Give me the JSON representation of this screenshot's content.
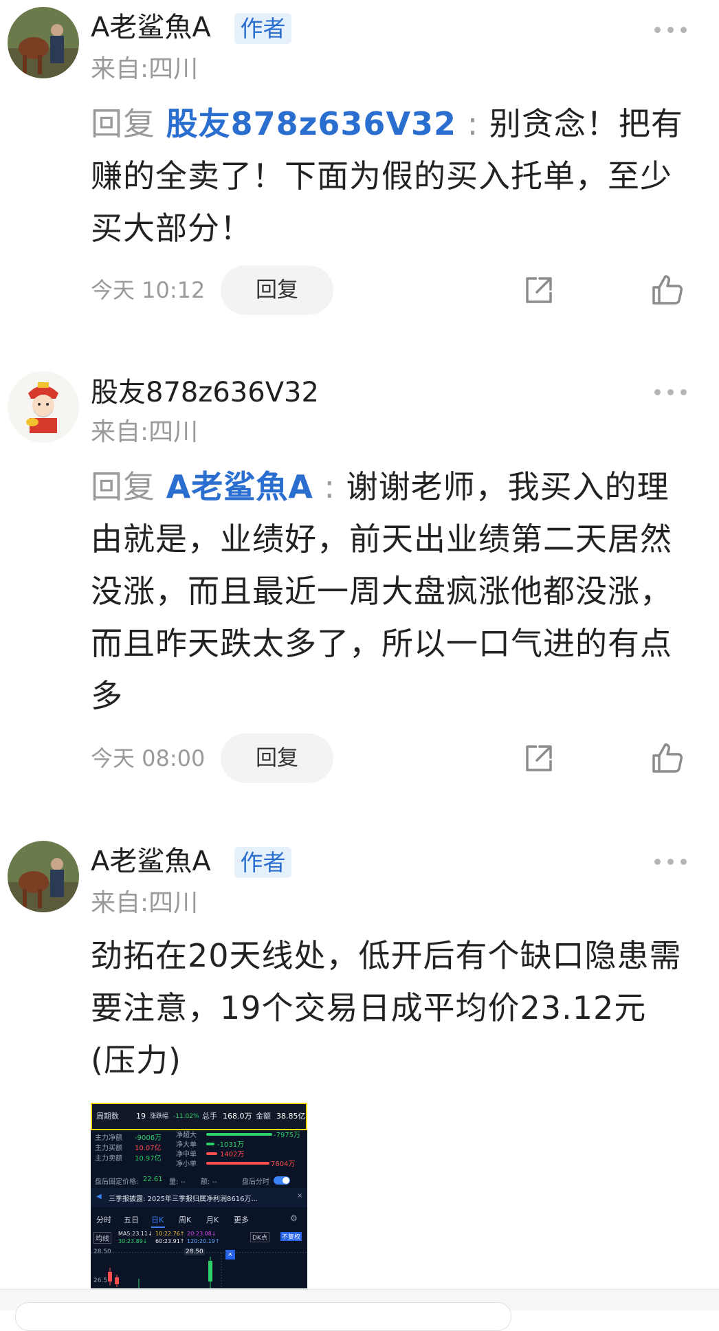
{
  "comments": [
    {
      "username": "A老鲨魚A",
      "badge": "作者",
      "location": "来自:四川",
      "reply_prefix": "回复",
      "mention": "股友878z636V32",
      "colon": " : ",
      "text": "别贪念！把有赚的全卖了！下面为假的买入托单，至少买大部分！",
      "timestamp": "今天 10:12",
      "reply_label": "回复"
    },
    {
      "username": "股友878z636V32",
      "location": "来自:四川",
      "reply_prefix": "回复",
      "mention": "A老鲨魚A",
      "colon": " : ",
      "text": "谢谢老师，我买入的理由就是，业绩好，前天出业绩第二天居然没涨，而且最近一周大盘疯涨他都没涨，而且昨天跌太多了，所以一口气进的有点多",
      "timestamp": "今天 08:00",
      "reply_label": "回复"
    },
    {
      "username": "A老鲨魚A",
      "badge": "作者",
      "location": "来自:四川",
      "text": "劲拓在20天线处，低开后有个缺口隐患需要注意，19个交易日成平均价23.12元(压力)"
    }
  ],
  "stock_image": {
    "top": {
      "period_label": "周期数",
      "period_value": "19",
      "change_label": "涨跌幅",
      "change_value": "-11.02%",
      "volume_label": "总手",
      "volume_value": "168.0万",
      "amount_label": "金额",
      "amount_value": "38.85亿"
    },
    "flows": [
      {
        "label": "主力净额",
        "value": "-9006万",
        "sub_label": "净超大",
        "sub_value": "-7975万"
      },
      {
        "label": "主力买额",
        "value": "10.07亿",
        "sub_label": "净大单",
        "sub_value": "-1031万"
      },
      {
        "label": "主力卖额",
        "value": "10.97亿",
        "sub_label": "净中单",
        "sub_value": "1402万"
      },
      {
        "label": "",
        "value": "",
        "sub_label": "净小单",
        "sub_value": "7604万"
      }
    ],
    "after_hours": "盘后固定价格:",
    "after_hours_price": "22.61",
    "after_hours_vol": "量: --",
    "after_hours_amt": "额: --",
    "after_hours_toggle": "盘后分时",
    "notice": "三季报披露: 2025年三季报归属净利润8616万...",
    "tabs": [
      "分时",
      "五日",
      "日K",
      "周K",
      "月K",
      "更多"
    ],
    "ma_label": "均线",
    "ma_values": [
      "MA5:23.11↓",
      "10:22.76↑",
      "20:23.08↓",
      "30:23.89↓",
      "60:23.91↑",
      "120:20.19↑"
    ],
    "dk_label": "DK点",
    "fq_label": "不复权",
    "price_high": "28.50",
    "price_mark": "28.50",
    "price_low": "26.5"
  },
  "colors": {
    "mention": "#2a6ecf",
    "badge_bg": "#e6f0fb",
    "muted": "#9a9a9a"
  }
}
